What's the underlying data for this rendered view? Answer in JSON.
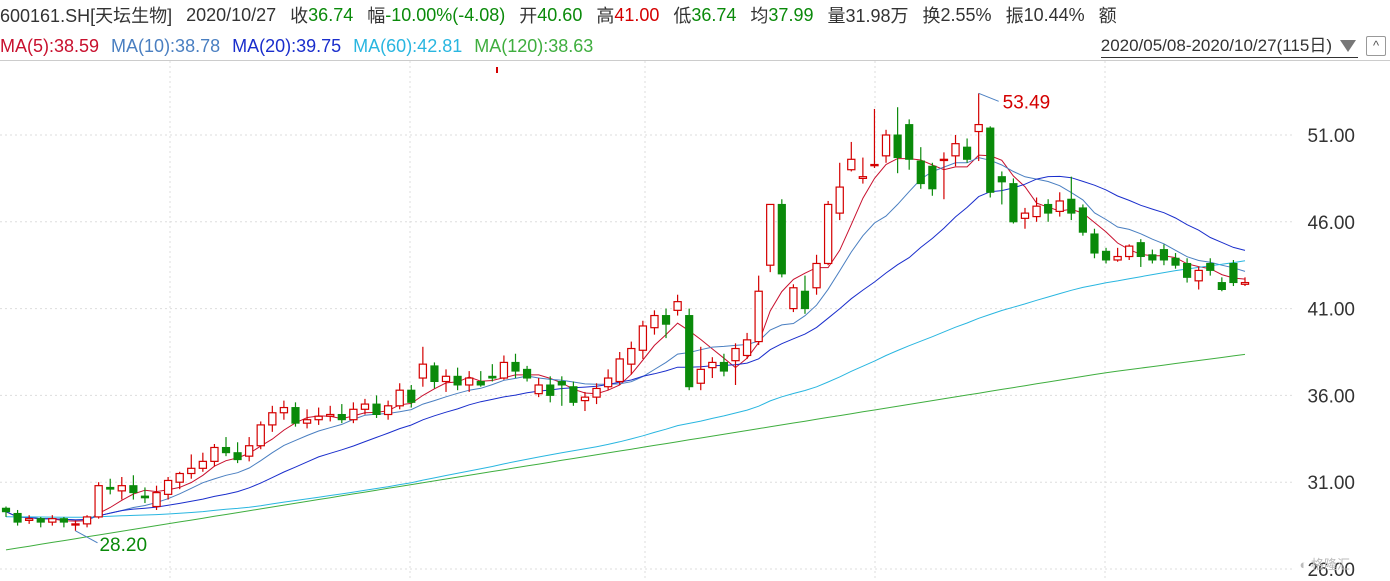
{
  "header": {
    "code": "600161.SH[天坛生物]",
    "date": "2020/10/27",
    "close_label": "收",
    "close_value": "36.74",
    "change_label": "幅",
    "change_value": "-10.00%(-4.08)",
    "open_label": "开",
    "open_value": "40.60",
    "high_label": "高",
    "high_value": "41.00",
    "low_label": "低",
    "low_value": "36.74",
    "avg_label": "均",
    "avg_value": "37.99",
    "volume_label": "量",
    "volume_value": "31.98万",
    "turnover_label": "换",
    "turnover_value": "2.55%",
    "amplitude_label": "振",
    "amplitude_value": "10.44%",
    "amount_label": "额"
  },
  "ma_legend": {
    "ma5": "MA(5):38.59",
    "ma10": "MA(10):38.78",
    "ma20": "MA(20):39.75",
    "ma60": "MA(60):42.81",
    "ma120": "MA(120):38.63"
  },
  "range": {
    "label": "2020/05/08-2020/10/27(115日)",
    "collapse": "^"
  },
  "watermark": "格隆汇",
  "colors": {
    "up": "#d40000",
    "down": "#0a8a0a",
    "ma5": "#c8102e",
    "ma10": "#4a7fc1",
    "ma20": "#1a2ecc",
    "ma60": "#29b6e0",
    "ma120": "#3fae3f"
  },
  "chart_data": {
    "type": "candlestick",
    "y_ticks": [
      "51.00",
      "46.00",
      "41.00",
      "36.00",
      "31.00",
      "26.00"
    ],
    "ylim": [
      26,
      56
    ],
    "annotations": [
      {
        "label": "53.49",
        "type": "high"
      },
      {
        "label": "28.20",
        "type": "low"
      }
    ],
    "candles": [
      [
        29.5,
        29.3,
        29.6,
        29.0
      ],
      [
        29.2,
        28.7,
        29.4,
        28.5
      ],
      [
        28.8,
        28.9,
        29.1,
        28.6
      ],
      [
        28.9,
        28.7,
        29.0,
        28.4
      ],
      [
        28.7,
        28.9,
        29.1,
        28.5
      ],
      [
        28.9,
        28.7,
        29.0,
        28.4
      ],
      [
        28.6,
        28.6,
        28.8,
        28.2
      ],
      [
        28.6,
        29.0,
        29.1,
        28.4
      ],
      [
        29.0,
        30.8,
        31.0,
        28.9
      ],
      [
        30.7,
        30.6,
        31.2,
        30.3
      ],
      [
        30.5,
        30.8,
        31.3,
        30.0
      ],
      [
        30.8,
        30.4,
        31.4,
        30.0
      ],
      [
        30.2,
        30.1,
        30.7,
        29.8
      ],
      [
        29.6,
        30.4,
        30.8,
        29.4
      ],
      [
        30.3,
        31.1,
        31.3,
        30.0
      ],
      [
        31.0,
        31.5,
        31.6,
        30.6
      ],
      [
        31.5,
        31.8,
        32.6,
        31.2
      ],
      [
        31.8,
        32.2,
        32.7,
        31.6
      ],
      [
        32.2,
        33.0,
        33.2,
        31.9
      ],
      [
        33.0,
        32.7,
        33.6,
        32.5
      ],
      [
        32.7,
        32.3,
        33.3,
        32.1
      ],
      [
        32.5,
        33.1,
        33.6,
        32.2
      ],
      [
        33.1,
        34.3,
        34.5,
        32.9
      ],
      [
        34.3,
        35.0,
        35.4,
        33.9
      ],
      [
        35.0,
        35.3,
        35.7,
        34.6
      ],
      [
        35.3,
        34.4,
        35.6,
        34.2
      ],
      [
        34.4,
        34.6,
        35.2,
        34.1
      ],
      [
        34.6,
        34.8,
        35.3,
        34.3
      ],
      [
        34.8,
        34.9,
        35.4,
        34.5
      ],
      [
        34.9,
        34.6,
        35.5,
        34.4
      ],
      [
        34.6,
        35.2,
        35.6,
        34.4
      ],
      [
        35.2,
        35.5,
        35.8,
        34.9
      ],
      [
        35.5,
        34.9,
        36.0,
        34.7
      ],
      [
        34.9,
        35.4,
        35.7,
        34.6
      ],
      [
        35.4,
        36.3,
        36.7,
        35.2
      ],
      [
        36.3,
        35.6,
        36.6,
        35.3
      ],
      [
        37.0,
        37.8,
        38.8,
        36.5
      ],
      [
        37.7,
        36.8,
        37.9,
        36.4
      ],
      [
        36.8,
        37.1,
        37.5,
        36.2
      ],
      [
        37.1,
        36.6,
        37.6,
        36.3
      ],
      [
        36.6,
        37.0,
        37.4,
        36.2
      ],
      [
        36.8,
        36.6,
        37.4,
        36.5
      ],
      [
        37.1,
        37.0,
        37.8,
        36.8
      ],
      [
        37.0,
        37.9,
        38.3,
        36.9
      ],
      [
        37.9,
        37.4,
        38.4,
        37.0
      ],
      [
        37.5,
        37.0,
        37.7,
        36.8
      ],
      [
        36.1,
        36.6,
        37.0,
        35.9
      ],
      [
        36.6,
        36.0,
        37.1,
        35.6
      ],
      [
        36.8,
        36.6,
        37.1,
        35.4
      ],
      [
        36.5,
        35.6,
        36.8,
        35.4
      ],
      [
        35.7,
        35.9,
        36.2,
        35.1
      ],
      [
        35.9,
        36.4,
        36.7,
        35.5
      ],
      [
        36.5,
        37.0,
        37.5,
        36.3
      ],
      [
        36.8,
        38.1,
        38.5,
        36.6
      ],
      [
        37.8,
        38.7,
        39.1,
        37.2
      ],
      [
        38.6,
        40.0,
        40.3,
        38.1
      ],
      [
        39.9,
        40.6,
        40.9,
        39.5
      ],
      [
        40.6,
        40.1,
        41.0,
        39.3
      ],
      [
        40.9,
        41.4,
        41.8,
        40.6
      ],
      [
        40.6,
        36.5,
        41.0,
        36.3
      ],
      [
        36.7,
        37.5,
        38.8,
        36.3
      ],
      [
        37.6,
        37.9,
        38.2,
        37.0
      ],
      [
        37.9,
        37.4,
        38.4,
        37.1
      ],
      [
        38.0,
        38.7,
        39.0,
        36.6
      ],
      [
        38.3,
        39.2,
        39.6,
        38.1
      ],
      [
        39.1,
        42.0,
        42.9,
        38.9
      ],
      [
        43.5,
        47.0,
        47.0,
        43.1
      ],
      [
        47.0,
        43.0,
        47.3,
        42.8
      ],
      [
        41.0,
        42.2,
        42.4,
        40.8
      ],
      [
        42.0,
        41.0,
        42.9,
        40.7
      ],
      [
        42.2,
        43.6,
        44.1,
        41.8
      ],
      [
        43.6,
        47.0,
        47.2,
        43.5
      ],
      [
        46.5,
        48.0,
        49.4,
        46.1
      ],
      [
        49.0,
        49.6,
        50.6,
        48.9
      ],
      [
        48.5,
        48.6,
        49.7,
        48.2
      ],
      [
        49.3,
        49.3,
        52.5,
        49.1
      ],
      [
        49.8,
        51.0,
        51.3,
        49.4
      ],
      [
        51.0,
        49.7,
        52.6,
        48.8
      ],
      [
        51.6,
        49.6,
        51.9,
        49.0
      ],
      [
        49.5,
        48.2,
        50.3,
        47.9
      ],
      [
        49.2,
        47.9,
        49.4,
        47.5
      ],
      [
        49.6,
        49.6,
        50.0,
        47.3
      ],
      [
        49.8,
        50.5,
        51.0,
        49.2
      ],
      [
        50.3,
        49.6,
        50.8,
        49.4
      ],
      [
        51.2,
        51.6,
        53.4,
        49.5
      ],
      [
        51.4,
        47.7,
        51.5,
        47.4
      ],
      [
        48.6,
        48.3,
        48.9,
        47.0
      ],
      [
        48.2,
        46.0,
        48.5,
        45.9
      ],
      [
        46.2,
        46.5,
        46.8,
        45.6
      ],
      [
        46.3,
        46.9,
        47.4,
        46.0
      ],
      [
        47.0,
        46.5,
        47.3,
        46.0
      ],
      [
        46.6,
        47.2,
        47.7,
        46.3
      ],
      [
        47.3,
        46.5,
        48.6,
        46.1
      ],
      [
        46.8,
        45.4,
        47.0,
        45.2
      ],
      [
        45.3,
        44.2,
        45.6,
        43.9
      ],
      [
        44.3,
        43.8,
        44.5,
        43.6
      ],
      [
        43.8,
        44.0,
        44.5,
        43.7
      ],
      [
        44.0,
        44.6,
        44.7,
        43.8
      ],
      [
        44.8,
        44.0,
        45.0,
        43.4
      ],
      [
        44.1,
        43.8,
        44.4,
        43.6
      ],
      [
        44.4,
        43.8,
        44.7,
        43.5
      ],
      [
        43.9,
        43.5,
        44.2,
        43.3
      ],
      [
        43.6,
        42.8,
        43.9,
        42.5
      ],
      [
        42.6,
        43.2,
        43.4,
        42.1
      ],
      [
        43.6,
        43.2,
        43.9,
        42.9
      ],
      [
        42.5,
        42.1,
        42.8,
        42.0
      ],
      [
        43.6,
        42.5,
        43.8,
        42.3
      ],
      [
        42.4,
        42.5,
        42.8,
        42.3
      ]
    ],
    "ma_series_labels": [
      "MA(5)",
      "MA(10)",
      "MA(20)",
      "MA(60)",
      "MA(120)"
    ]
  }
}
